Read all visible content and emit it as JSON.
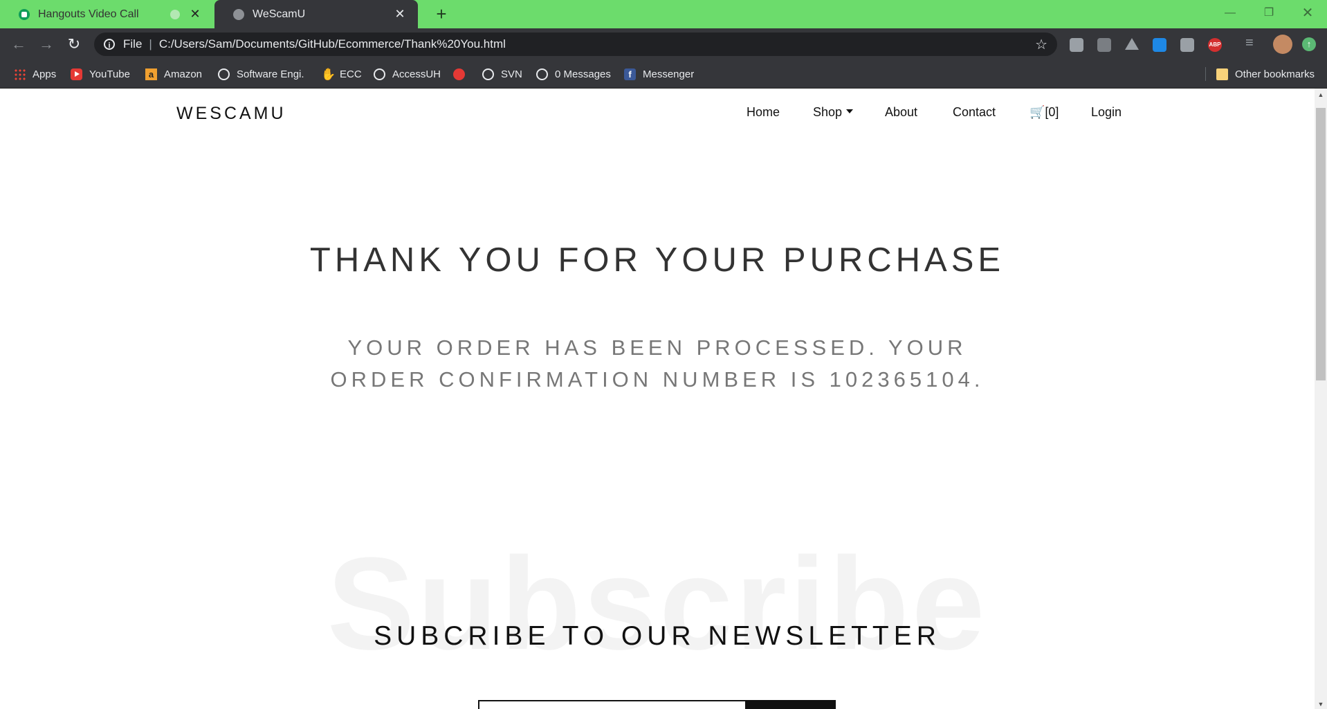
{
  "browser": {
    "tabs": [
      {
        "title": "Hangouts Video Call"
      },
      {
        "title": "WeScamU"
      }
    ],
    "omnibox": {
      "scheme": "File",
      "url": "C:/Users/Sam/Documents/GitHub/Ecommerce/Thank%20You.html"
    },
    "bookmarks": {
      "apps": "Apps",
      "youtube": "YouTube",
      "amazon": "Amazon",
      "software": "Software Engi.",
      "ecc": "ECC",
      "accessuh": "AccessUH",
      "svn": "SVN",
      "messages": "0 Messages",
      "messenger": "Messenger",
      "other": "Other bookmarks"
    },
    "extensions": {
      "abp": "ABP"
    }
  },
  "site": {
    "brand": "WESCAMU",
    "nav": {
      "home": "Home",
      "shop": "Shop",
      "about": "About",
      "contact": "Contact",
      "cart": "[0]",
      "login": "Login"
    },
    "thank_you": "THANK YOU FOR YOUR PURCHASE",
    "order_message": "YOUR ORDER HAS BEEN PROCESSED. YOUR ORDER CONFIRMATION NUMBER IS 102365104.",
    "subscribe_watermark": "Subscribe",
    "newsletter_heading": "SUBCRIBE TO OUR NEWSLETTER",
    "email_value": ""
  },
  "colors": {
    "tabstrip": "#6cdc6c",
    "toolbar": "#35363a",
    "text": "#111111"
  }
}
